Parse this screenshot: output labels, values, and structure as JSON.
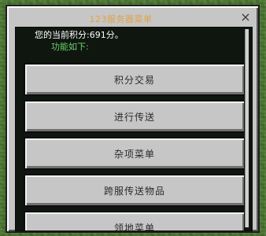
{
  "dialog": {
    "title": "123服务器菜单",
    "close_glyph": "×",
    "close_icon": "close-icon"
  },
  "content": {
    "points_line": "您的当前积分:691分。",
    "features_line": "功能如下:"
  },
  "buttons": [
    {
      "label": "积分交易"
    },
    {
      "label": "进行传送"
    },
    {
      "label": "杂项菜单"
    },
    {
      "label": "跨服传送物品"
    },
    {
      "label": "领地菜单"
    }
  ],
  "colors": {
    "title": "#e0a347",
    "features": "#6cd26c",
    "panel": "#c6c6c6",
    "content_bg": "#0f160f"
  }
}
